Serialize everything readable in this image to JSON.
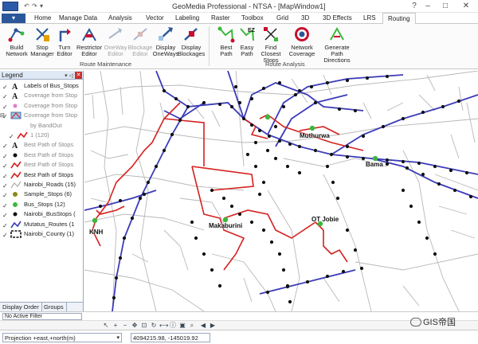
{
  "app": {
    "title": "GeoMedia Professional - NTSA - [MapWindow1]",
    "file_tab": "",
    "quick_access": [
      "↶",
      "↷",
      "▾"
    ]
  },
  "tabs": [
    {
      "label": "Home",
      "active": false
    },
    {
      "label": "Manage Data",
      "active": false
    },
    {
      "label": "Analysis",
      "active": false
    },
    {
      "label": "Vector",
      "active": false
    },
    {
      "label": "Labeling",
      "active": false
    },
    {
      "label": "Raster",
      "active": false
    },
    {
      "label": "Toolbox",
      "active": false
    },
    {
      "label": "Grid",
      "active": false
    },
    {
      "label": "3D",
      "active": false
    },
    {
      "label": "3D Effects",
      "active": false
    },
    {
      "label": "LRS",
      "active": false
    },
    {
      "label": "Routing",
      "active": true
    }
  ],
  "ribbon": {
    "buttons": [
      {
        "label1": "Build",
        "label2": "Network",
        "icon": "build-network-icon",
        "enabled": true
      },
      {
        "label1": "Stop",
        "label2": "Manager",
        "icon": "stop-manager-icon",
        "enabled": true
      },
      {
        "label1": "Turn",
        "label2": "Editor",
        "icon": "turn-editor-icon",
        "enabled": true
      },
      {
        "label1": "Restrictor",
        "label2": "Editor",
        "icon": "restrictor-editor-icon",
        "enabled": true
      },
      {
        "label1": "OneWay",
        "label2": "Editor",
        "icon": "oneway-editor-icon",
        "enabled": false
      },
      {
        "label1": "Blockage",
        "label2": "Editor",
        "icon": "blockage-editor-icon",
        "enabled": false
      },
      {
        "label1": "Display",
        "label2": "OneWays",
        "icon": "display-oneways-icon",
        "enabled": true
      },
      {
        "label1": "Display",
        "label2": "Blockages",
        "icon": "display-blockages-icon",
        "enabled": true
      },
      {
        "label1": "Best",
        "label2": "Path",
        "icon": "best-path-icon",
        "enabled": true
      },
      {
        "label1": "Easy",
        "label2": "Path",
        "icon": "easy-path-icon",
        "enabled": true
      },
      {
        "label1": "Find Closest",
        "label2": "Stops",
        "icon": "find-closest-stops-icon",
        "enabled": true
      },
      {
        "label1": "Network",
        "label2": "Coverage",
        "icon": "network-coverage-icon",
        "enabled": true
      },
      {
        "label1": "Generate Path",
        "label2": "Directions",
        "icon": "generate-path-directions-icon",
        "enabled": true
      }
    ],
    "groups": [
      "Route Maintenance",
      "Route Analysis"
    ]
  },
  "legend": {
    "title": "Legend",
    "rows": [
      {
        "label": "Labels of Bus_Stops",
        "checked": true,
        "symbol": "label-A",
        "faded": false,
        "indent": 0
      },
      {
        "label": "Coverage from Stop",
        "checked": true,
        "symbol": "label-A",
        "faded": true,
        "indent": 0
      },
      {
        "label": "Coverage from Stop",
        "checked": true,
        "symbol": "pink-dot",
        "faded": true,
        "indent": 0
      },
      {
        "label": "Coverage from Stop",
        "checked": true,
        "symbol": "coverage",
        "faded": true,
        "indent": 0
      },
      {
        "label": "by BandOut",
        "checked": null,
        "symbol": "none",
        "faded": true,
        "indent": 1
      },
      {
        "label": "1 (120)",
        "checked": true,
        "symbol": "red-line",
        "faded": true,
        "indent": 1
      },
      {
        "label": "Best Path of Stops",
        "checked": true,
        "symbol": "label-A",
        "faded": true,
        "indent": 0
      },
      {
        "label": "Best Path of Stops",
        "checked": true,
        "symbol": "black-dot",
        "faded": true,
        "indent": 0
      },
      {
        "label": "Best Path of Stops",
        "checked": true,
        "symbol": "red-line",
        "faded": true,
        "indent": 0
      },
      {
        "label": "Best Path of Stops",
        "checked": true,
        "symbol": "red-line",
        "faded": false,
        "indent": 0
      },
      {
        "label": "Nairobi_Roads (15)",
        "checked": true,
        "symbol": "gray-line",
        "faded": false,
        "indent": 0
      },
      {
        "label": "Sample_Stops (6)",
        "checked": true,
        "symbol": "olive-dot",
        "faded": false,
        "indent": 0
      },
      {
        "label": "Bus_Stops (12)",
        "checked": true,
        "symbol": "green-dot",
        "faded": false,
        "indent": 0
      },
      {
        "label": "Nairobi_BusStops (",
        "checked": true,
        "symbol": "black-dot",
        "faded": false,
        "indent": 0
      },
      {
        "label": "Mutatus_Routes (1",
        "checked": true,
        "symbol": "blue-line",
        "faded": false,
        "indent": 0
      },
      {
        "label": "Nairobi_County (1)",
        "checked": true,
        "symbol": "county",
        "faded": false,
        "indent": 0
      }
    ],
    "footer_tabs": [
      "Display Order",
      "Groups"
    ]
  },
  "map": {
    "labels": [
      "Muthurwa",
      "Bama",
      "KNH",
      "Makaburini",
      "OT Jobie"
    ]
  },
  "status": {
    "filter": "No Active Filter",
    "projection": "Projection +east,+north(m)",
    "coordinates": "4094215.98, -145019.92"
  },
  "toolbar_icons": [
    "select-icon",
    "zoom-in-icon",
    "zoom-out-icon",
    "pan-icon",
    "fit-icon",
    "refresh-icon",
    "measure-icon",
    "info-icon",
    "overview-icon",
    "magnify-icon",
    "back-icon",
    "forward-icon"
  ],
  "watermark": "GIS帝国",
  "colors": {
    "route_red": "#d62020",
    "route_blue": "#3b3bb8",
    "road_gray": "#b8b8b8",
    "stop_green": "#3cb83c",
    "accent": "#2b579a"
  }
}
